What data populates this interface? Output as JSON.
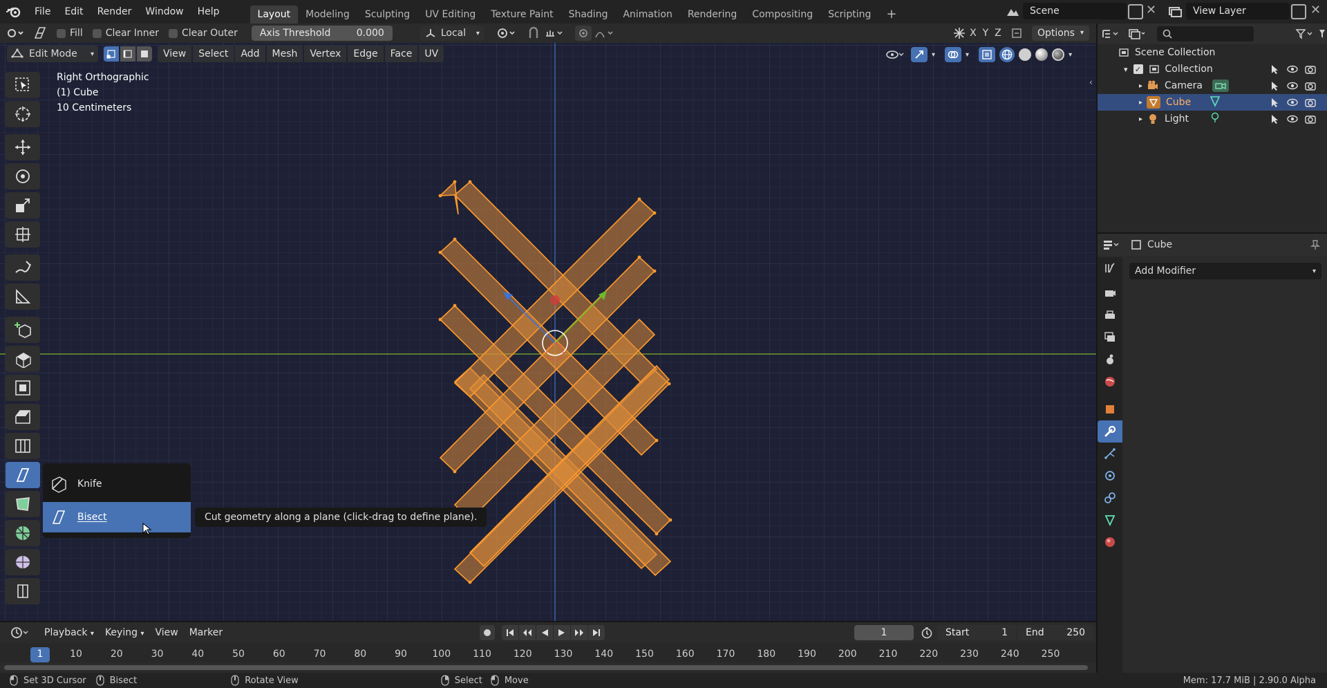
{
  "app": {
    "menus": [
      "File",
      "Edit",
      "Render",
      "Window",
      "Help"
    ],
    "workspaces": [
      {
        "label": "Layout",
        "active": true
      },
      {
        "label": "Modeling",
        "active": false
      },
      {
        "label": "Sculpting",
        "active": false
      },
      {
        "label": "UV Editing",
        "active": false
      },
      {
        "label": "Texture Paint",
        "active": false
      },
      {
        "label": "Shading",
        "active": false
      },
      {
        "label": "Animation",
        "active": false
      },
      {
        "label": "Rendering",
        "active": false
      },
      {
        "label": "Compositing",
        "active": false
      },
      {
        "label": "Scripting",
        "active": false
      }
    ],
    "add_workspace": "+",
    "scene": "Scene",
    "view_layer": "View Layer"
  },
  "tool_header": {
    "fill": "Fill",
    "clear_inner": "Clear Inner",
    "clear_outer": "Clear Outer",
    "axis_threshold_label": "Axis Threshold",
    "axis_threshold_value": "0.000",
    "orientation": "Local",
    "axes": [
      "X",
      "Y",
      "Z"
    ],
    "options": "Options"
  },
  "viewport_header": {
    "mode": "Edit Mode",
    "menus": [
      "View",
      "Select",
      "Add",
      "Mesh",
      "Vertex",
      "Edge",
      "Face",
      "UV"
    ]
  },
  "viewport": {
    "view_name": "Right Orthographic",
    "object_label": "(1) Cube",
    "scale_label": "10 Centimeters"
  },
  "tool_popup": {
    "items": [
      {
        "label": "Knife",
        "highlighted": false
      },
      {
        "label": "Bisect",
        "highlighted": true
      }
    ],
    "tooltip": "Cut geometry along a plane (click-drag to define plane)."
  },
  "outliner": {
    "root": "Scene Collection",
    "collection": "Collection",
    "objects": [
      {
        "name": "Camera",
        "selected": false
      },
      {
        "name": "Cube",
        "selected": true
      },
      {
        "name": "Light",
        "selected": false
      }
    ]
  },
  "properties": {
    "object_name": "Cube",
    "add_modifier": "Add Modifier"
  },
  "timeline": {
    "menus": [
      "Playback",
      "Keying",
      "View",
      "Marker"
    ],
    "current_frame": "1",
    "start_label": "Start",
    "start": "1",
    "end_label": "End",
    "end": "250",
    "ticks": [
      "1",
      "10",
      "20",
      "30",
      "40",
      "50",
      "60",
      "70",
      "80",
      "90",
      "100",
      "110",
      "120",
      "130",
      "140",
      "150",
      "160",
      "170",
      "180",
      "190",
      "200",
      "210",
      "220",
      "230",
      "240",
      "250"
    ]
  },
  "status_bar": {
    "set_cursor": "Set 3D Cursor",
    "bisect": "Bisect",
    "rotate_view": "Rotate View",
    "select": "Select",
    "move": "Move",
    "info": "Mem: 17.7 MiB | 2.90.0 Alpha"
  },
  "colors": {
    "accent": "#4772b3",
    "mesh_fill": "#d98a3a",
    "mesh_edge": "#ff9a2e",
    "viewport_bg": "#1e2135",
    "selected_row": "#334d80"
  }
}
